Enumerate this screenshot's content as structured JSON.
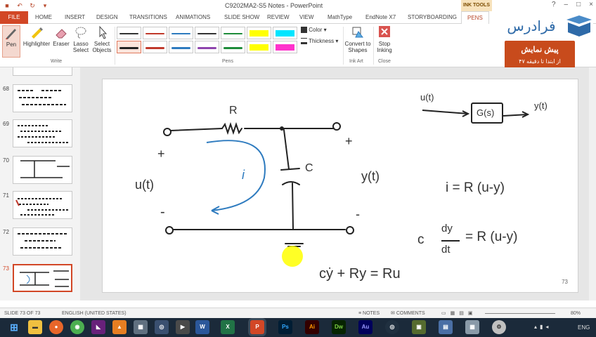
{
  "app": {
    "title": "C9202MA2-S5 Notes - PowerPoint",
    "context_tab_group": "INK TOOLS"
  },
  "tabs": [
    "FILE",
    "HOME",
    "INSERT",
    "DESIGN",
    "TRANSITIONS",
    "ANIMATIONS",
    "SLIDE SHOW",
    "REVIEW",
    "VIEW",
    "MathType",
    "EndNote X7",
    "STORYBOARDING",
    "PENS"
  ],
  "ribbon": {
    "write": {
      "pen": "Pen",
      "highlighter": "Highlighter",
      "eraser": "Eraser",
      "lasso": "Lasso Select",
      "select": "Select Objects",
      "label": "Write"
    },
    "pens_label": "Pens",
    "color": "Color",
    "thickness": "Thickness",
    "ink_art": {
      "convert": "Convert to Shapes",
      "label": "Ink Art"
    },
    "close": {
      "stop": "Stop Inking",
      "label": "Close"
    },
    "pen_colors": [
      "#333333",
      "#c0392b",
      "#2e7bbf",
      "#333333",
      "#1e8c3a",
      "#ffff00",
      "#00e5ff",
      "#333333",
      "#c0392b",
      "#2e7bbf",
      "#8e44ad",
      "#1e8c3a",
      "#ffff00",
      "#ff33cc"
    ]
  },
  "thumbnails": [
    {
      "num": "68"
    },
    {
      "num": "69"
    },
    {
      "num": "70"
    },
    {
      "num": "71"
    },
    {
      "num": "72"
    },
    {
      "num": "73",
      "selected": true
    }
  ],
  "slide": {
    "number": "73",
    "labels": {
      "R": "R",
      "C": "C",
      "i": "i",
      "u": "u(t)",
      "y": "y(t)",
      "plus": "+",
      "minus": "-",
      "bd_in": "u(t)",
      "bd_block": "G(s)",
      "bd_out": "y(t)",
      "eq1": "i = R (u-y)",
      "eq2_left": "c",
      "eq2_num": "dy",
      "eq2_den": "dt",
      "eq2_right": "= R (u-y)",
      "eq3": "cẏ + Ry = Ru"
    }
  },
  "promo": {
    "title": "پیش نمایش",
    "subtitle": "از ابتدا تا دقیقه ۴۷",
    "logo_text": "فرادرس"
  },
  "status": {
    "slide": "SLIDE 73 OF 73",
    "language": "ENGLISH (UNITED STATES)",
    "notes": "NOTES",
    "comments": "COMMENTS",
    "zoom": "80%"
  },
  "taskbar": {
    "lang": "ENG",
    "apps": [
      "W",
      "X",
      "P",
      "Ps",
      "Ai",
      "Dw",
      "Au"
    ]
  }
}
